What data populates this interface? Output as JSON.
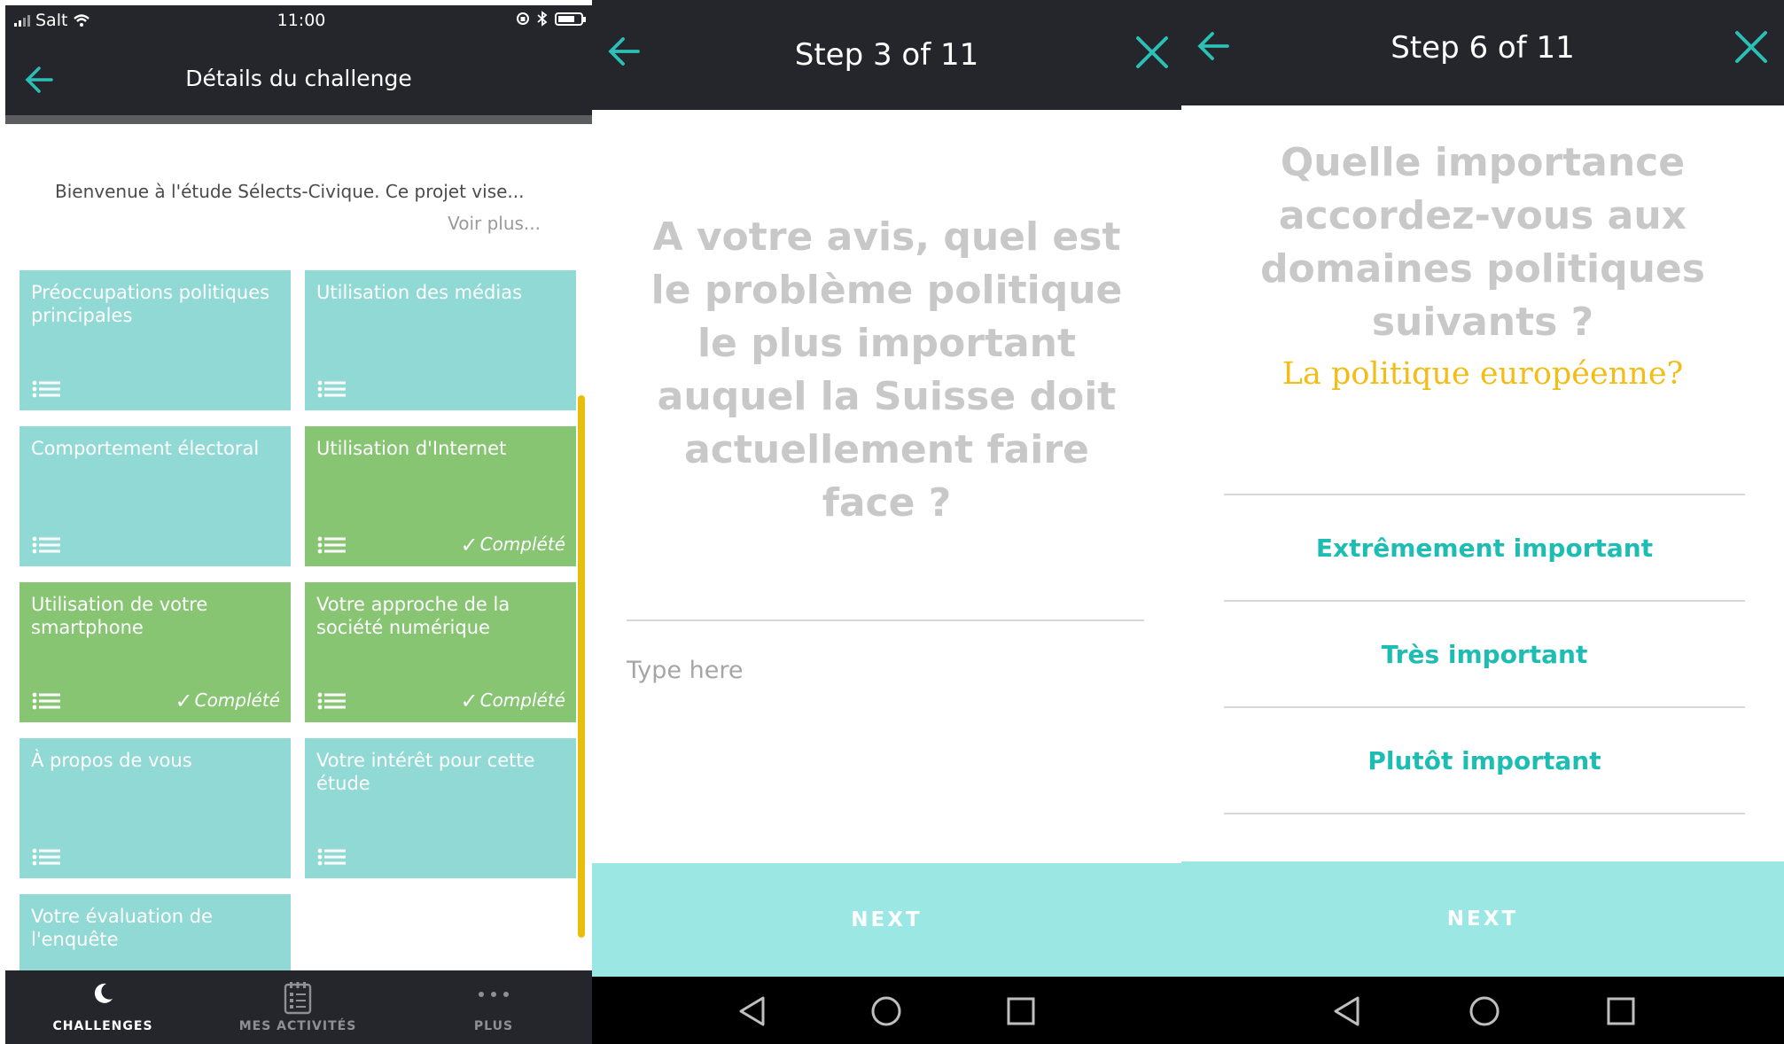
{
  "colors": {
    "dark_header": "#24262b",
    "teal_tile": "#90d9d5",
    "green_tile": "#87c573",
    "accent": "#1ebdb4",
    "next_button": "#9ae7e3",
    "subquestion": "#f1bd16",
    "scrollbar": "#e9be0a"
  },
  "screen1": {
    "status": {
      "carrier": "Salt",
      "time": "11:00"
    },
    "nav": {
      "title": "Détails du challenge",
      "back_icon": "arrow-left-icon"
    },
    "intro": {
      "text": "Bienvenue à l'étude Sélects-Civique. Ce projet vise...",
      "more": "Voir plus..."
    },
    "tiles": [
      {
        "label": "Préoccupations politiques principales",
        "color": "teal",
        "status": ""
      },
      {
        "label": "Utilisation des médias",
        "color": "teal",
        "status": ""
      },
      {
        "label": "Comportement électoral",
        "color": "teal",
        "status": ""
      },
      {
        "label": "Utilisation d'Internet",
        "color": "green",
        "status": "Complété"
      },
      {
        "label": "Utilisation de votre smartphone",
        "color": "green",
        "status": "Complété"
      },
      {
        "label": "Votre approche de la société numérique",
        "color": "green",
        "status": "Complété"
      },
      {
        "label": "À propos de vous",
        "color": "teal",
        "status": ""
      },
      {
        "label": "Votre intérêt pour cette étude",
        "color": "teal",
        "status": ""
      },
      {
        "label": "Votre évaluation de l'enquête",
        "color": "teal",
        "status": ""
      }
    ],
    "tabbar": [
      {
        "label": "CHALLENGES",
        "icon": "moon-icon",
        "active": true
      },
      {
        "label": "MES ACTIVITÉS",
        "icon": "checklist-icon",
        "active": false
      },
      {
        "label": "PLUS",
        "icon": "more-dots-icon",
        "active": false
      }
    ]
  },
  "screen2": {
    "step": "Step 3 of 11",
    "question": "A votre avis, quel est le problème politique le plus important auquel la Suisse doit actuellement faire face ?",
    "input_placeholder": "Type here",
    "next_label": "NEXT"
  },
  "screen3": {
    "step": "Step 6 of 11",
    "question": "Quelle importance accordez-vous aux domaines politiques suivants ?",
    "subquestion": "La politique européenne?",
    "options": [
      "Extrêmement important",
      "Très important",
      "Plutôt important"
    ],
    "next_label": "NEXT"
  }
}
